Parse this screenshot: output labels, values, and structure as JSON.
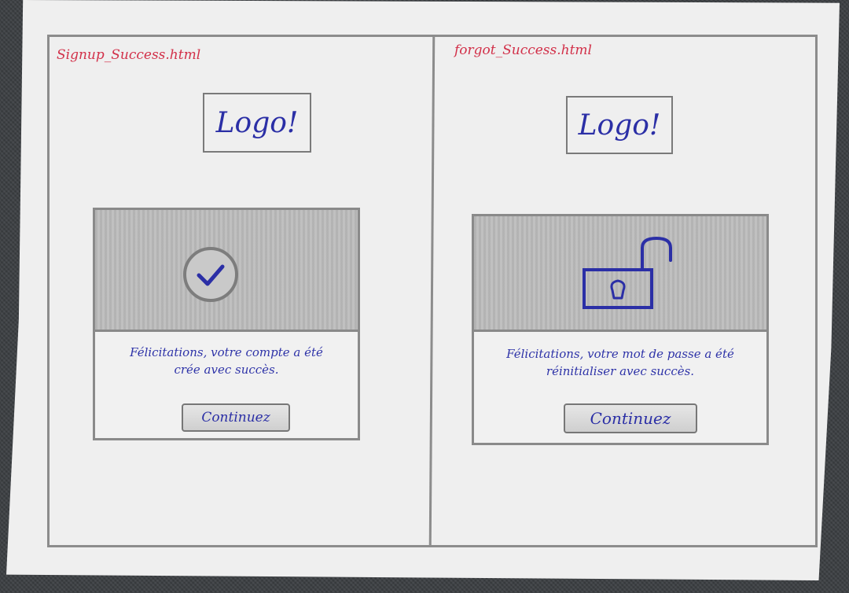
{
  "left_panel": {
    "filename": "Signup_Success.html",
    "logo": "Logo!",
    "message_line1": "Félicitations, votre compte a été",
    "message_line2": "crée avec succès.",
    "button_label": "Continuez",
    "icon": "check-circle-icon"
  },
  "right_panel": {
    "filename": "forgot_Success.html",
    "logo": "Logo!",
    "message_line1": "Félicitations, votre mot de passe a été",
    "message_line2": "réinitialiser avec succès.",
    "button_label": "Continuez",
    "icon": "unlocked-padlock-icon"
  },
  "colors": {
    "ink_blue": "#2b2fa6",
    "filename_red": "#d23049",
    "pencil_gray": "#8a8a8a"
  }
}
